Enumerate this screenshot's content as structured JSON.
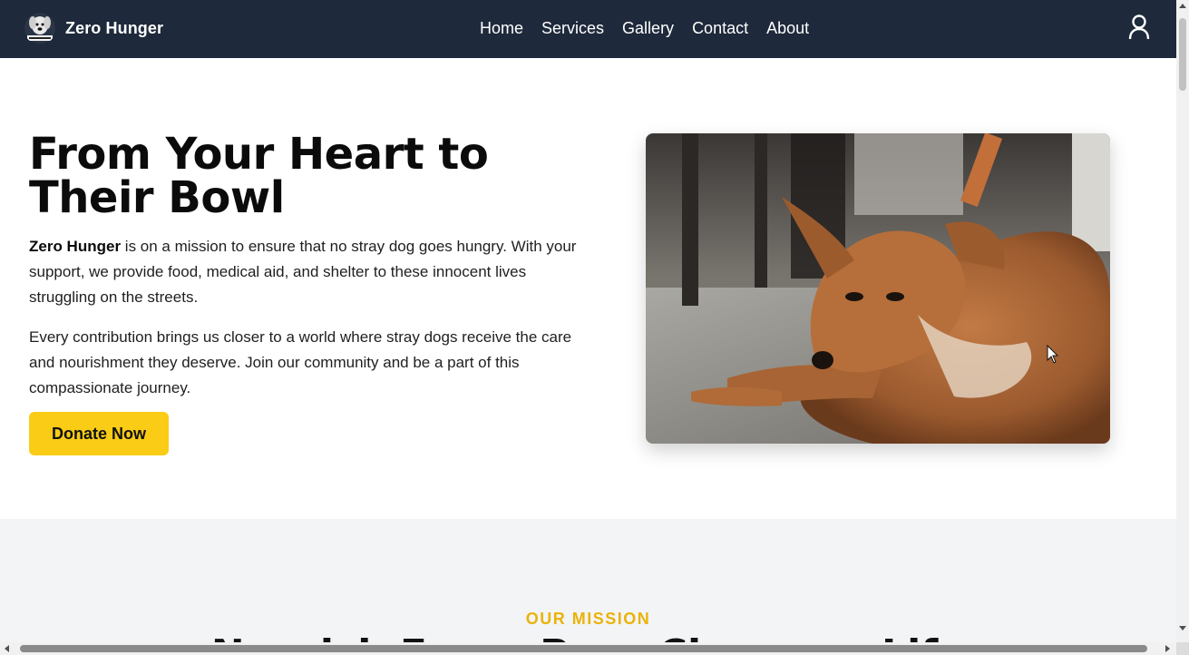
{
  "navbar": {
    "brand_name": "Zero Hunger",
    "logo_icon": "dog-logo-icon",
    "links": [
      {
        "label": "Home"
      },
      {
        "label": "Services"
      },
      {
        "label": "Gallery"
      },
      {
        "label": "Contact"
      },
      {
        "label": "About"
      }
    ],
    "user_icon": "user-icon",
    "background": "#1e293b"
  },
  "hero": {
    "title": "From Your Heart to Their Bowl",
    "p1_bold": "Zero Hunger",
    "p1_rest": " is on a mission to ensure that no stray dog goes hungry. With your support, we provide food, medical aid, and shelter to these innocent lives struggling on the streets.",
    "p2": "Every contribution brings us closer to a world where stray dogs receive the care and nourishment they deserve. Join our community and be a part of this compassionate journey.",
    "donate_label": "Donate Now",
    "accent": "#facc15"
  },
  "mission": {
    "label": "OUR MISSION",
    "heading": "Nourish Every Paw, Change a Life",
    "background": "#f3f4f6",
    "label_color": "#eab308"
  }
}
